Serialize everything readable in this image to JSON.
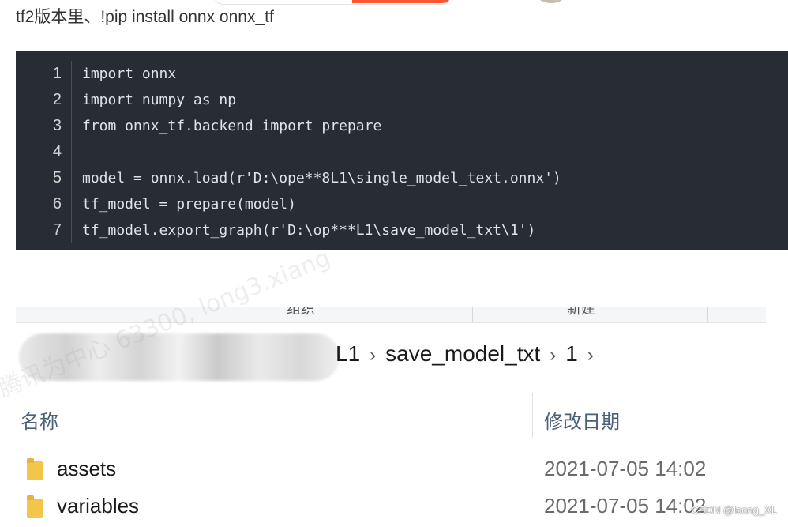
{
  "intro_text": "tf2版本里、!pip install onnx onnx_tf",
  "code": {
    "lines": [
      {
        "n": "1",
        "text": "import onnx"
      },
      {
        "n": "2",
        "text": "import numpy as np"
      },
      {
        "n": "3",
        "text": "from onnx_tf.backend import prepare"
      },
      {
        "n": "4",
        "text": ""
      },
      {
        "n": "5",
        "text": "model = onnx.load(r'D:\\ope**8L1\\single_model_text.onnx')"
      },
      {
        "n": "6",
        "text": "tf_model = prepare(model)"
      },
      {
        "n": "7",
        "text": "tf_model.export_graph(r'D:\\op***L1\\save_model_txt\\1')"
      }
    ]
  },
  "explorer": {
    "ribbon": {
      "group_label": "组织",
      "new_label": "新建"
    },
    "breadcrumb": [
      "L1",
      "save_model_txt",
      "1"
    ],
    "columns": {
      "name": "名称",
      "modified": "修改日期"
    },
    "files": [
      {
        "name": "assets",
        "date": "2021-07-05 14:02"
      },
      {
        "name": "variables",
        "date": "2021-07-05 14:02"
      }
    ]
  },
  "watermark": "腾讯为中心 63300, long3.xiang",
  "credit": "CSDN @loong_XL",
  "colors": {
    "code_bg": "#282c34",
    "accent": "#fc5531",
    "folder": "#f3c64b"
  }
}
